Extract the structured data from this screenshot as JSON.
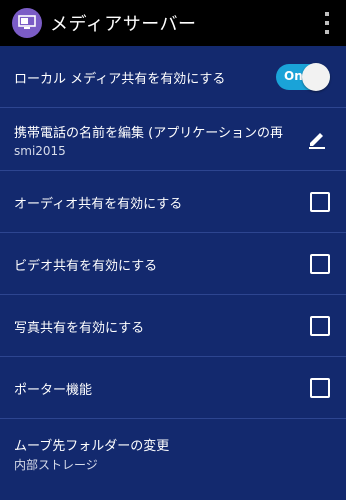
{
  "header": {
    "title": "メディアサーバー",
    "app_icon": "media-server-icon",
    "overflow_icon": "overflow-menu-icon"
  },
  "colors": {
    "background": "#13296e",
    "header": "#000000",
    "toggle_on": "#1aa3d8",
    "app_icon": "#7b5cc6"
  },
  "settings": {
    "local_share": {
      "title": "ローカル メディア共有を有効にする",
      "toggle_label": "On",
      "enabled": true
    },
    "device_name": {
      "title": "携帯電話の名前を編集 (アプリケーションの再",
      "value": "smi2015",
      "icon": "edit-pencil-icon"
    },
    "audio_share": {
      "title": "オーディオ共有を有効にする",
      "checked": false
    },
    "video_share": {
      "title": "ビデオ共有を有効にする",
      "checked": false
    },
    "photo_share": {
      "title": "写真共有を有効にする",
      "checked": false
    },
    "porter": {
      "title": "ポーター機能",
      "checked": false
    },
    "move_folder": {
      "title": "ムーブ先フォルダーの変更",
      "value": "内部ストレージ"
    }
  }
}
